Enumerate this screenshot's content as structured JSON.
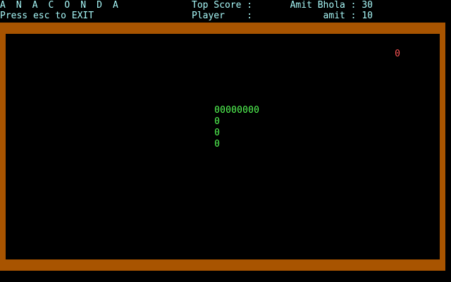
{
  "window": {
    "title": "A N A C O N D A",
    "exit_hint": "Press esc to EXIT"
  },
  "scores": {
    "top_score_label": "Top Score :",
    "top_score_value": "Amit Bhola : 30",
    "player_label": "Player    :",
    "player_value": "amit : 10"
  },
  "colors": {
    "hud_text": "#a8f8f8",
    "border": "#a85400",
    "snake": "#54fc54",
    "food": "#fc5454",
    "background": "#000000"
  },
  "game": {
    "snake_glyph": "0",
    "food_glyph": "0",
    "snake_segments": [
      {
        "col": 38,
        "row": 8
      },
      {
        "col": 39,
        "row": 8
      },
      {
        "col": 40,
        "row": 8
      },
      {
        "col": 41,
        "row": 8
      },
      {
        "col": 42,
        "row": 8
      },
      {
        "col": 43,
        "row": 8
      },
      {
        "col": 44,
        "row": 8
      },
      {
        "col": 45,
        "row": 8
      },
      {
        "col": 38,
        "row": 9
      },
      {
        "col": 38,
        "row": 10
      },
      {
        "col": 38,
        "row": 11
      }
    ],
    "food": {
      "col": 70,
      "row": 3
    }
  }
}
